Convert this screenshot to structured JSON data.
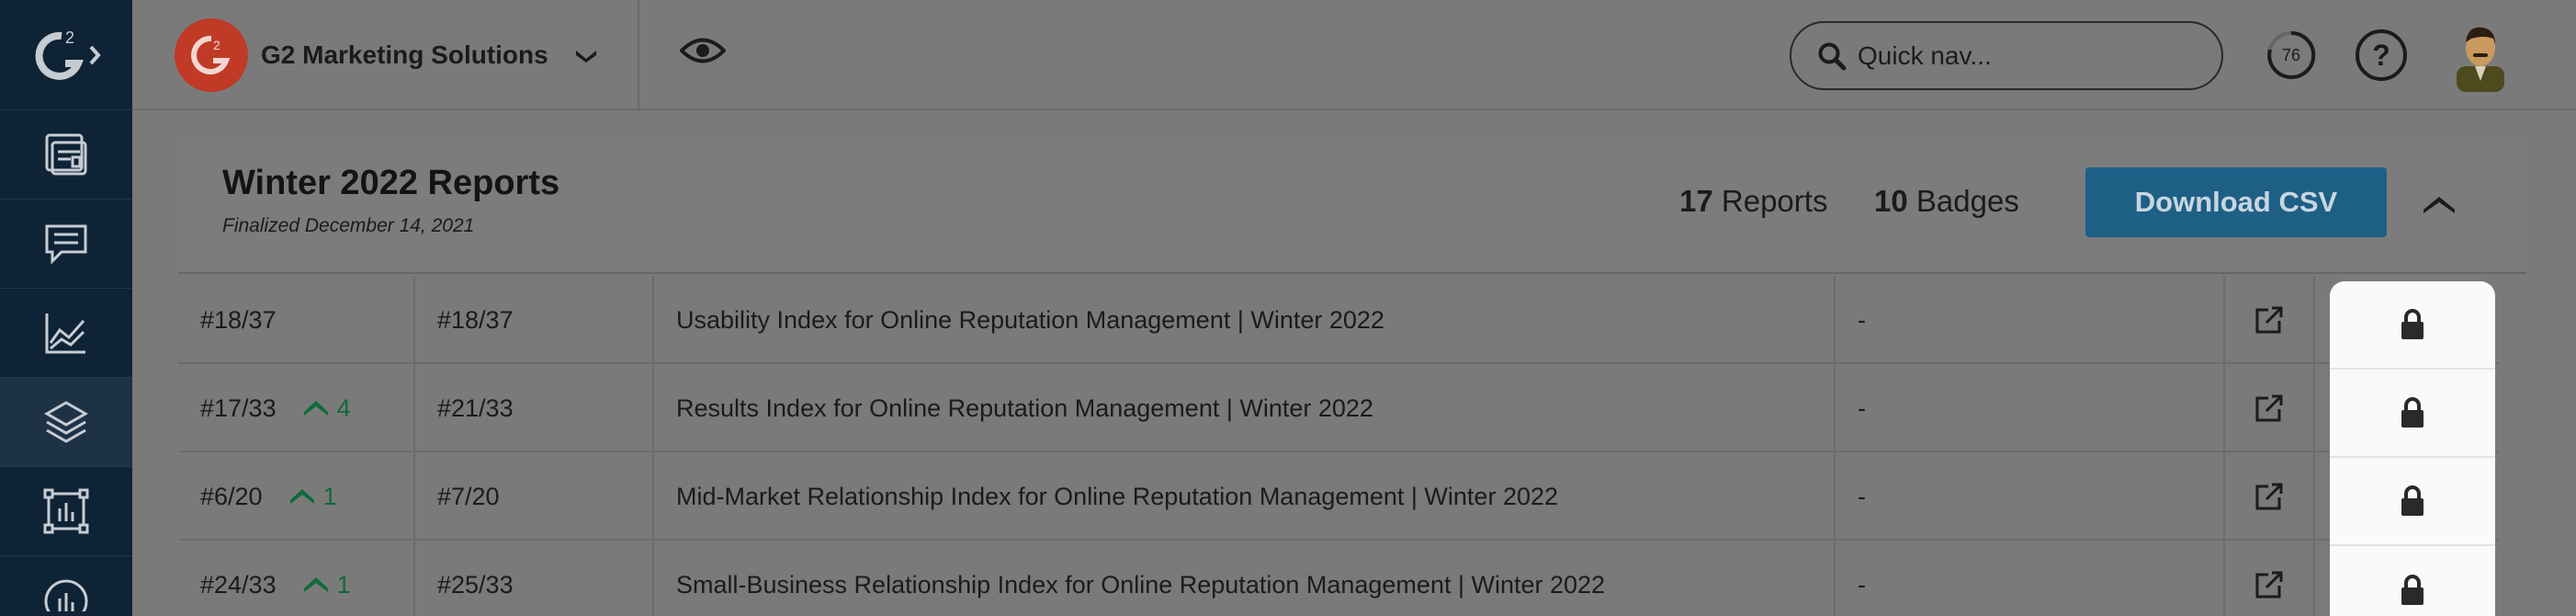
{
  "topbar": {
    "company_name": "G2 Marketing Solutions",
    "search_placeholder": "Quick nav...",
    "progress_value": "76",
    "help_label": "?"
  },
  "nav": {
    "items": [
      "logo",
      "dashboard",
      "reviews",
      "reports",
      "layers",
      "frame",
      "analytics"
    ],
    "active": "layers"
  },
  "report": {
    "title": "Winter 2022 Reports",
    "subtitle": "Finalized December 14, 2021",
    "reports_count": "17",
    "reports_label": "Reports",
    "badges_count": "10",
    "badges_label": "Badges",
    "download_label": "Download CSV"
  },
  "rows": [
    {
      "rank": "#18/37",
      "trend": "",
      "prev_rank": "#18/37",
      "name": "Usability Index for Online Reputation Management | Winter 2022",
      "badge": "-"
    },
    {
      "rank": "#17/33",
      "trend": "4",
      "prev_rank": "#21/33",
      "name": "Results Index for Online Reputation Management | Winter 2022",
      "badge": "-"
    },
    {
      "rank": "#6/20",
      "trend": "1",
      "prev_rank": "#7/20",
      "name": "Mid-Market Relationship Index for Online Reputation Management | Winter 2022",
      "badge": "-"
    },
    {
      "rank": "#24/33",
      "trend": "1",
      "prev_rank": "#25/33",
      "name": "Small-Business Relationship Index for Online Reputation Management | Winter 2022",
      "badge": "-"
    }
  ],
  "colors": {
    "nav_bg": "#0e2336",
    "brand_red": "#c03a26",
    "button_blue": "#1e5f85",
    "trend_green": "#0f6a3b"
  }
}
